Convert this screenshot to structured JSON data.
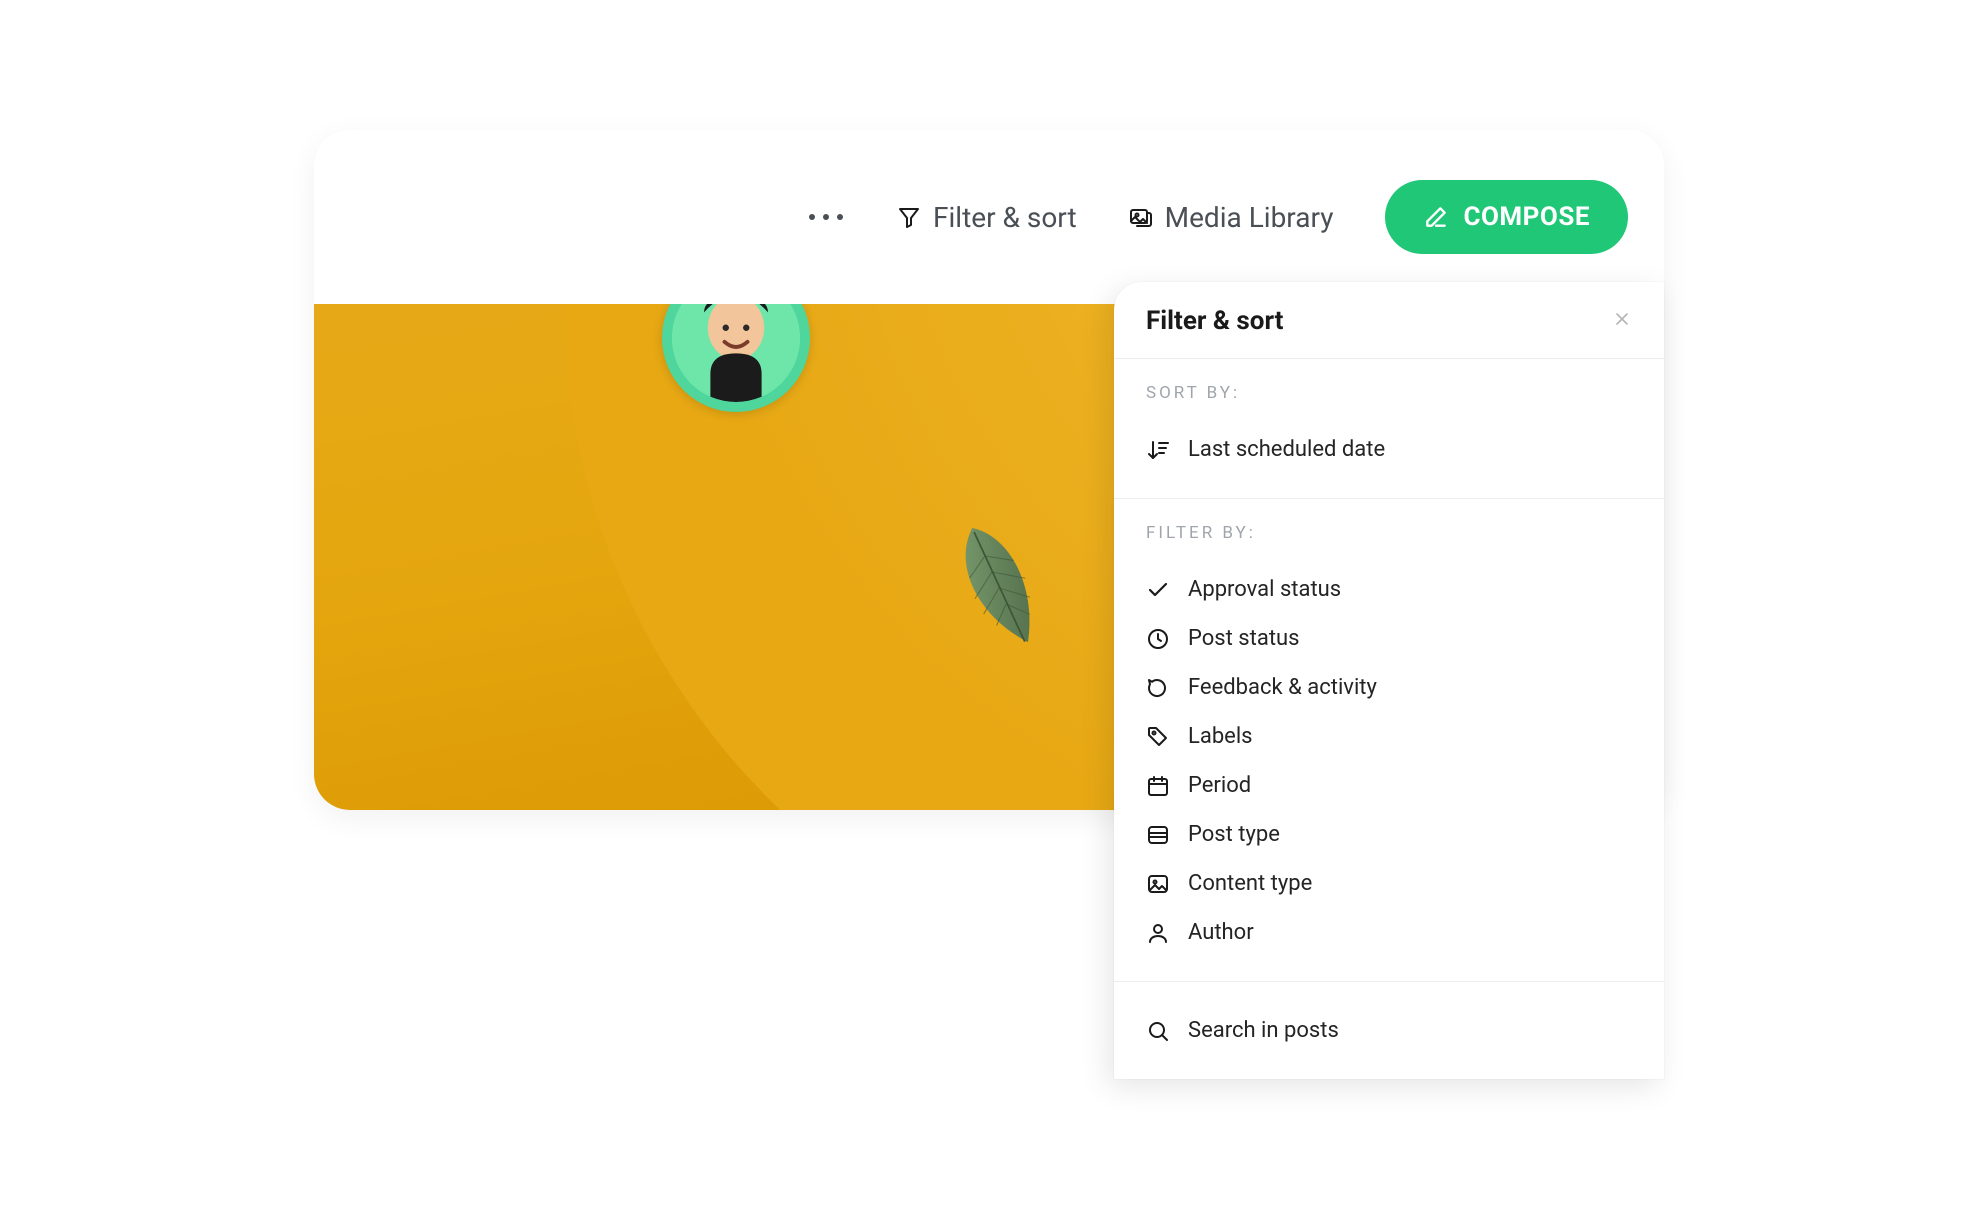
{
  "toolbar": {
    "filter_sort_label": "Filter & sort",
    "media_library_label": "Media Library",
    "compose_label": "COMPOSE"
  },
  "panel": {
    "title": "Filter & sort",
    "sort_by_label": "SORT BY:",
    "sort_option": "Last scheduled date",
    "filter_by_label": "FILTER BY:",
    "filters": [
      {
        "icon": "check",
        "label": "Approval status"
      },
      {
        "icon": "clock",
        "label": "Post status"
      },
      {
        "icon": "comment",
        "label": "Feedback & activity"
      },
      {
        "icon": "tag",
        "label": "Labels"
      },
      {
        "icon": "calendar",
        "label": "Period"
      },
      {
        "icon": "image-stack",
        "label": "Post type"
      },
      {
        "icon": "image",
        "label": "Content type"
      },
      {
        "icon": "user",
        "label": "Author"
      }
    ],
    "search_label": "Search in posts"
  },
  "colors": {
    "accent": "#20c777",
    "bg_hero": "#e6a817"
  }
}
